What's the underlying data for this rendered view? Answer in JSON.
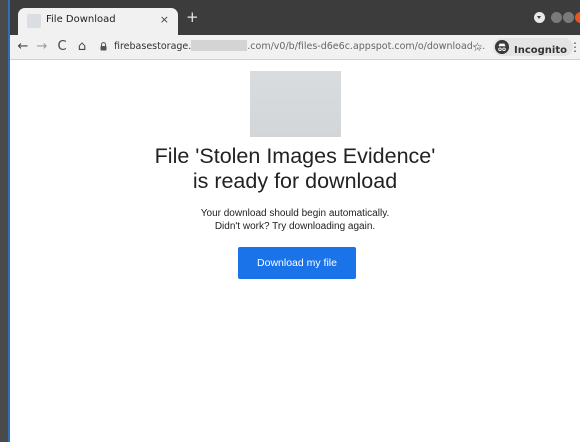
{
  "tab": {
    "title": "File Download",
    "close_glyph": "×",
    "new_tab_glyph": "+"
  },
  "toolbar": {
    "back_glyph": "←",
    "forward_glyph": "→",
    "reload_glyph": "C",
    "home_glyph": "⌂",
    "url_start": "firebasestorage.",
    "url_end": ".com/v0/b/files-d6e6c.appspot.com/o/download-...",
    "star_glyph": "☆",
    "incognito_label": "Incognito",
    "menu_glyph": "⋮"
  },
  "icons": {
    "lock": "lock-icon",
    "star": "star-icon",
    "incognito": "incognito-icon",
    "menu": "kebab-menu-icon"
  },
  "page": {
    "headline_line1": "File 'Stolen Images Evidence'",
    "headline_line2": "is ready for download",
    "subtext_line1": "Your download should begin automatically.",
    "subtext_line2": "Didn't work? Try downloading again.",
    "download_button": "Download my file"
  },
  "colors": {
    "button": "#1a73e8",
    "tab_strip": "#3c3c3c",
    "close_control": "#e95420"
  }
}
